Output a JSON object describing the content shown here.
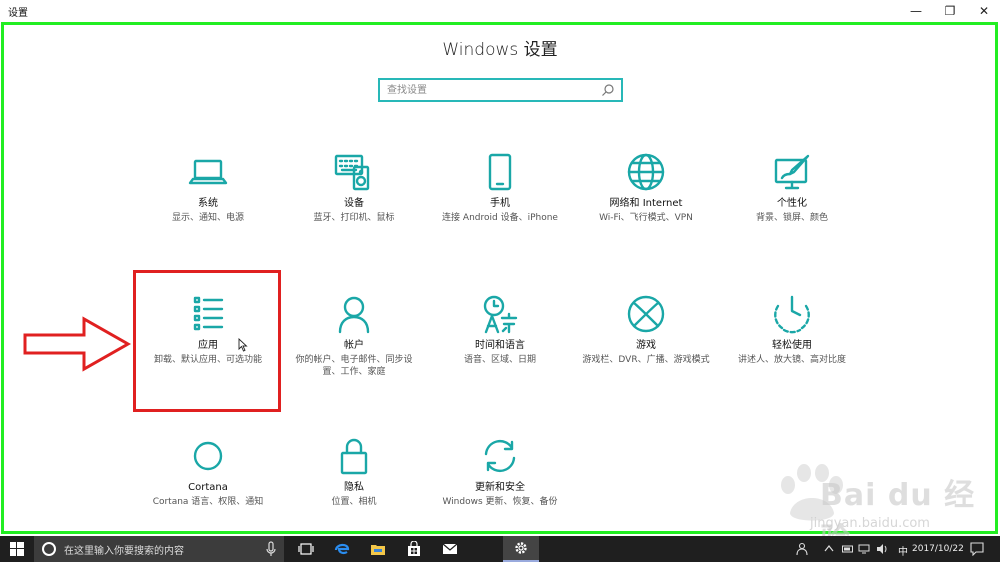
{
  "window": {
    "title": "设置",
    "minimize_glyph": "—",
    "maximize_glyph": "❐",
    "close_glyph": "✕"
  },
  "heading": "Windows 设置",
  "search": {
    "placeholder": "查找设置",
    "icon": "search-icon"
  },
  "tiles": [
    {
      "name": "系统",
      "desc": "显示、通知、电源",
      "icon": "laptop-icon"
    },
    {
      "name": "设备",
      "desc": "蓝牙、打印机、鼠标",
      "icon": "keyboard-speaker-icon"
    },
    {
      "name": "手机",
      "desc": "连接 Android 设备、iPhone",
      "icon": "phone-icon"
    },
    {
      "name": "网络和 Internet",
      "desc": "Wi-Fi、飞行模式、VPN",
      "icon": "globe-icon"
    },
    {
      "name": "个性化",
      "desc": "背景、锁屏、颜色",
      "icon": "paint-icon"
    },
    {
      "name": "应用",
      "desc": "卸载、默认应用、可选功能",
      "icon": "apps-list-icon"
    },
    {
      "name": "帐户",
      "desc": "你的帐户、电子邮件、同步设置、工作、家庭",
      "icon": "person-icon"
    },
    {
      "name": "时间和语言",
      "desc": "语音、区域、日期",
      "icon": "time-language-icon"
    },
    {
      "name": "游戏",
      "desc": "游戏栏、DVR、广播、游戏模式",
      "icon": "xbox-icon"
    },
    {
      "name": "轻松使用",
      "desc": "讲述人、放大镜、高对比度",
      "icon": "ease-of-access-icon"
    },
    {
      "name": "Cortana",
      "desc": "Cortana 语言、权限、通知",
      "icon": "cortana-icon"
    },
    {
      "name": "隐私",
      "desc": "位置、相机",
      "icon": "lock-icon"
    },
    {
      "name": "更新和安全",
      "desc": "Windows 更新、恢复、备份",
      "icon": "update-icon"
    }
  ],
  "watermark": {
    "text": "Bai du 经验",
    "url": "jingyan.baidu.com"
  },
  "taskbar": {
    "search_placeholder": "在这里输入你要搜索的内容",
    "language": "中",
    "date": "2017/10/22"
  },
  "colors": {
    "accent": "#1aa7a7",
    "frame": "#22ee22",
    "highlight": "#e02020",
    "taskbar": "#1f1f1f"
  }
}
